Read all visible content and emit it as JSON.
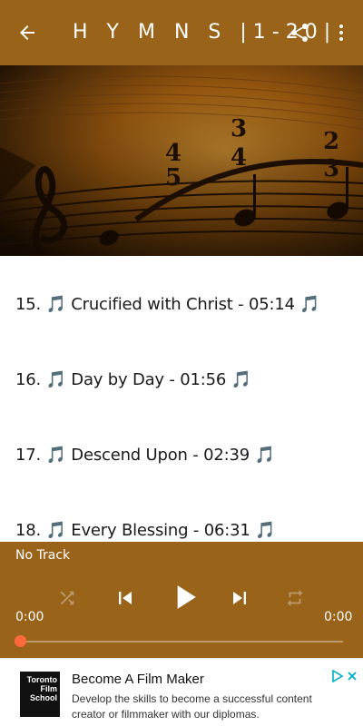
{
  "toolbar": {
    "title": "H Y M N S  |1-20|",
    "back_icon": "arrow-left-icon",
    "share_icon": "share-icon",
    "more_icon": "more-vert-icon",
    "color": "#996319"
  },
  "hymns": [
    {
      "label": "15. 🎵 Crucified with Christ - 05:14 🎵"
    },
    {
      "label": "16. 🎵 Day by Day - 01:56 🎵"
    },
    {
      "label": "17. 🎵 Descend Upon - 02:39 🎵"
    },
    {
      "label": "18. 🎵 Every Blessing - 06:31 🎵"
    }
  ],
  "player": {
    "track_name": "No Track",
    "elapsed": "0:00",
    "duration": "0:00",
    "progress": 0,
    "seek_color": "#ff6a3d"
  },
  "ad": {
    "logo_lines": [
      "Toronto",
      "Film",
      "School"
    ],
    "title": "Become A Film Maker",
    "description": "Develop the skills to become a successful content creator or filmmaker with our diplomas.",
    "adchoices_color": "#00aecd"
  }
}
